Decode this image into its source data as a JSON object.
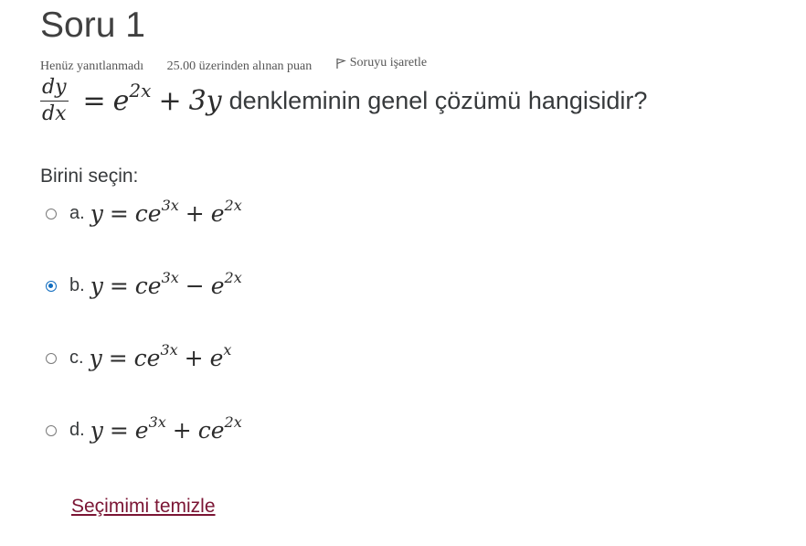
{
  "question": {
    "title": "Soru 1",
    "status": "Henüz yanıtlanmadı",
    "points": "25.00 üzerinden alınan puan",
    "flag_label": "Soruyu işaretle",
    "equation": {
      "numerator": "dy",
      "denominator": "dx",
      "equals": "=",
      "base": "e",
      "exponent": "2x",
      "plus": "+",
      "term": "3y"
    },
    "text": "denkleminin genel çözümü hangisidir?"
  },
  "answer": {
    "prompt": "Birini seçin:",
    "selected": "b",
    "options": [
      {
        "letter": "a.",
        "lhs": "y",
        "eq": "=",
        "t1": "ce",
        "e1": "3x",
        "op": "+",
        "t2": "e",
        "e2": "2x",
        "checked": false
      },
      {
        "letter": "b.",
        "lhs": "y",
        "eq": "=",
        "t1": "ce",
        "e1": "3x",
        "op": "−",
        "t2": "e",
        "e2": "2x",
        "checked": true
      },
      {
        "letter": "c.",
        "lhs": "y",
        "eq": "=",
        "t1": "ce",
        "e1": "3x",
        "op": "+",
        "t2": "e",
        "e2": "x",
        "checked": false
      },
      {
        "letter": "d.",
        "lhs": "y",
        "eq": "=",
        "t1": "e",
        "e1": "3x",
        "op": "+",
        "t2": "ce",
        "e2": "2x",
        "checked": false
      }
    ],
    "clear_label": "Seçimimi temizle"
  },
  "colors": {
    "accent": "#0f6cbf",
    "link": "#7b1534"
  },
  "icons": {
    "flag": "flag-icon"
  }
}
